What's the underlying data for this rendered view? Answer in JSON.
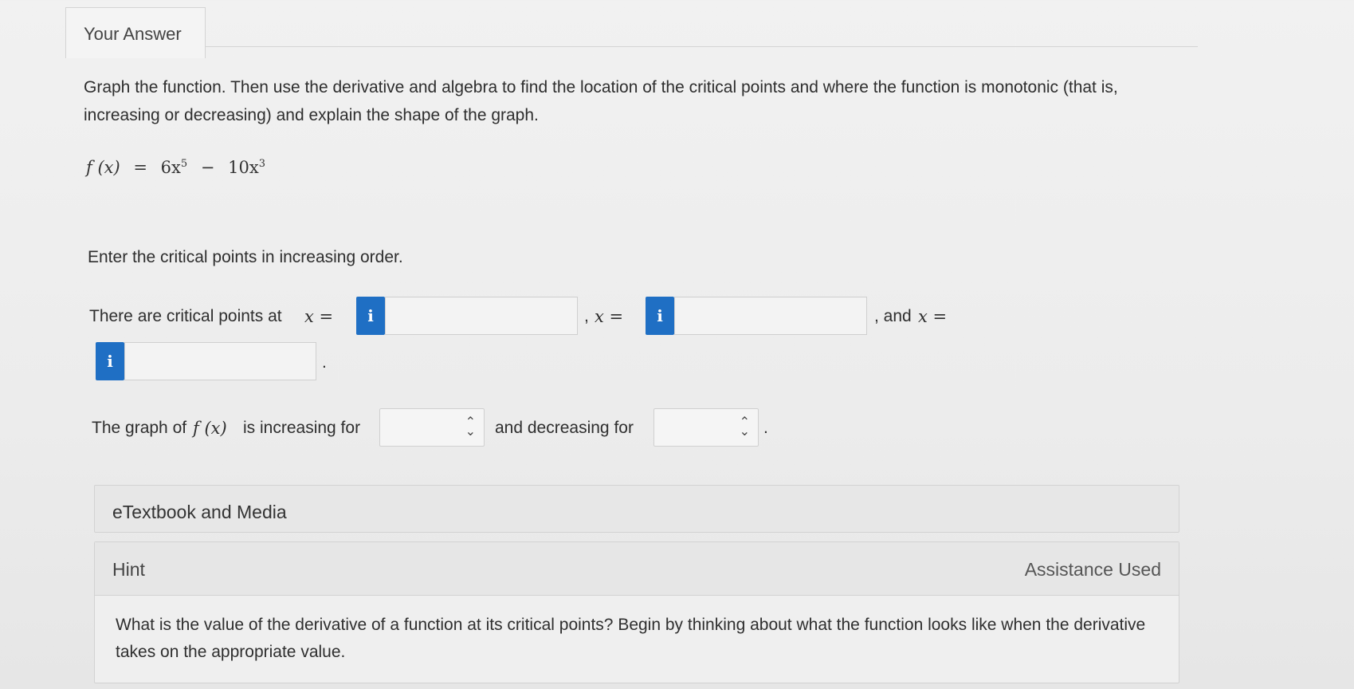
{
  "tab": {
    "label": "Your Answer"
  },
  "question": {
    "prompt": "Graph the function. Then use the derivative and algebra to find the location of the critical points and where the function is monotonic (that is, increasing or decreasing) and explain the shape of the graph.",
    "formula": {
      "lhs": "f (x)",
      "eq": "=",
      "t1_coef": "6x",
      "t1_exp": "5",
      "minus": "−",
      "t2_coef": "10x",
      "t2_exp": "3"
    },
    "instruction": "Enter the critical points in increasing order."
  },
  "critical_points": {
    "label_prefix": "There are critical points at",
    "x_eq": "x =",
    "sep1": ",",
    "sep2": ", and",
    "end": ".",
    "info_icon_glyph": "i",
    "values": [
      "",
      "",
      ""
    ]
  },
  "monotonic": {
    "prefix": "The graph of",
    "fx": "f (x)",
    "inc_label": "is increasing for",
    "dec_label": "and decreasing for",
    "end": ".",
    "increasing_value": "",
    "decreasing_value": ""
  },
  "etextbook": {
    "label": "eTextbook and Media"
  },
  "hint": {
    "title": "Hint",
    "status": "Assistance Used",
    "text": "What is the value of the derivative of a function at its critical points? Begin by thinking about what the function looks like when the derivative takes on the appropriate value."
  },
  "colors": {
    "info_button": "#1f6fc4",
    "panel_bg": "#e7e7e7"
  }
}
